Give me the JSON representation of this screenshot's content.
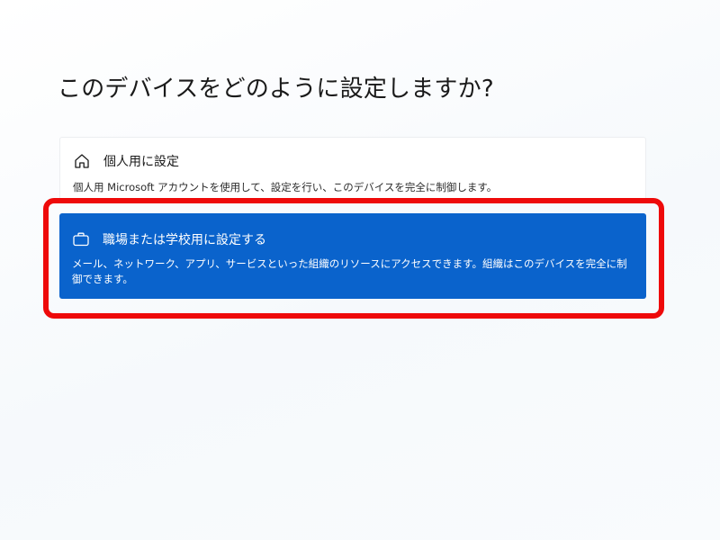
{
  "page": {
    "title": "このデバイスをどのように設定しますか?"
  },
  "options": {
    "personal": {
      "icon": "home-icon",
      "label": "個人用に設定",
      "description": "個人用 Microsoft アカウントを使用して、設定を行い、このデバイスを完全に制御します。"
    },
    "work": {
      "icon": "briefcase-icon",
      "label": "職場または学校用に設定する",
      "description": "メール、ネットワーク、アプリ、サービスといった組織のリソースにアクセスできます。組織はこのデバイスを完全に制御できます。",
      "selected": true
    }
  },
  "colors": {
    "selected_background": "#0a63cc",
    "highlight_border": "#ee0a0a"
  }
}
